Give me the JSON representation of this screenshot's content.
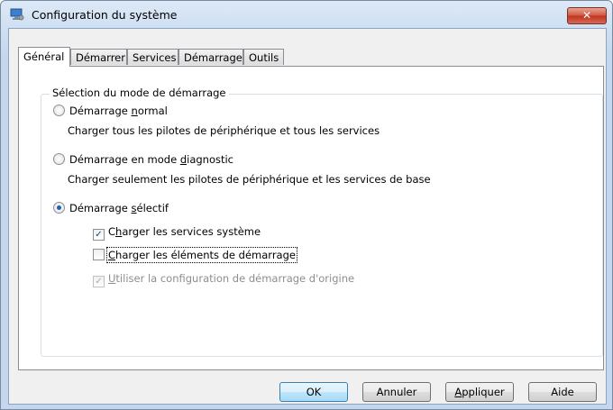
{
  "window": {
    "title": "Configuration du système",
    "close_glyph": "✕"
  },
  "tabs": [
    {
      "label": "Général",
      "active": true
    },
    {
      "label": "Démarrer",
      "active": false
    },
    {
      "label": "Services",
      "active": false
    },
    {
      "label": "Démarrage",
      "active": false
    },
    {
      "label": "Outils",
      "active": false
    }
  ],
  "group": {
    "label": "Sélection du mode de démarrage"
  },
  "options": {
    "normal": {
      "label_pre": "Démarrage ",
      "label_key": "n",
      "label_post": "ormal",
      "selected": false,
      "description": "Charger tous les pilotes de périphérique et tous les services"
    },
    "diagnostic": {
      "label_pre": "Démarrage en mode ",
      "label_key": "d",
      "label_post": "iagnostic",
      "selected": false,
      "description": "Charger seulement les pilotes de périphérique et les services de base"
    },
    "selective": {
      "label_pre": "Démarrage ",
      "label_key": "s",
      "label_post": "électif",
      "selected": true
    }
  },
  "checkboxes": {
    "system_services": {
      "label_pre": "C",
      "label_key": "h",
      "label_post": "arger les services système",
      "checked": true,
      "enabled": true
    },
    "startup_items": {
      "label_pre": "",
      "label_key": "C",
      "label_post": "harger les éléments de démarrage",
      "checked": false,
      "enabled": true
    },
    "original_config": {
      "label_pre": "",
      "label_key": "U",
      "label_post": "tiliser la configuration de démarrage d'origine",
      "checked": true,
      "enabled": false
    }
  },
  "buttons": {
    "ok": "OK",
    "cancel": "Annuler",
    "apply_key": "A",
    "apply_rest": "ppliquer",
    "help": "Aide"
  },
  "colors": {
    "accent": "#1f5fb8",
    "close": "#c1321b"
  }
}
